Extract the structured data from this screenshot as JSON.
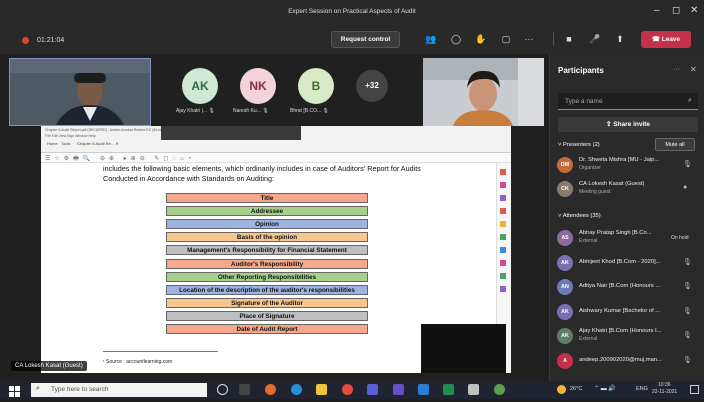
{
  "window": {
    "title": "Expert Session on Practical Aspects of Audit"
  },
  "meeting": {
    "timer": "01:21:04",
    "request_control": "Request control",
    "leave": "Leave"
  },
  "gallery": {
    "avatars": [
      {
        "initials": "AK",
        "name": "Ajay Khatri |...",
        "bg": "#cfe8d4",
        "fg": "#2e6b3d"
      },
      {
        "initials": "NK",
        "name": "Naresh Ku...",
        "bg": "#f3d3da",
        "fg": "#8a2c43"
      },
      {
        "initials": "B",
        "name": "Bhrat [B.CO...",
        "bg": "#d7ebc9",
        "fg": "#456b2c"
      }
    ],
    "more": "+32"
  },
  "presenter_label": "CA Lokesh Kasat (Guest)",
  "document": {
    "intro": "includes the following basic elements, which ordinarily includes in case of Auditors' Report for Audits Conducted in Accordance with Standards on Auditing:",
    "steps": [
      {
        "label": "Title",
        "color": "#f4a98a"
      },
      {
        "label": "Addressee",
        "color": "#a8d08d"
      },
      {
        "label": "Opinion",
        "color": "#9db4e3"
      },
      {
        "label": "Basis of the opinion",
        "color": "#f7c58e"
      },
      {
        "label": "Management's Responsibility for Financial Statement",
        "color": "#bfbfbf"
      },
      {
        "label": "Auditor's Responsibility",
        "color": "#f4a98a"
      },
      {
        "label": "Other Reporting Responsibilities",
        "color": "#a8d08d"
      },
      {
        "label": "Location of the description of the auditor's responsibilities",
        "color": "#9db4e3"
      },
      {
        "label": "Signature of the Auditor",
        "color": "#f7c58e"
      },
      {
        "label": "Place of Signature",
        "color": "#bfbfbf"
      },
      {
        "label": "Date of Audit Report",
        "color": "#f4a98a"
      }
    ],
    "source": "¹ Source : accountlearning.com"
  },
  "participants": {
    "title": "Participants",
    "search_placeholder": "Type a name",
    "share_invite": "Share invite",
    "presenters_header": "Presenters (2)",
    "mute_all": "Mute all",
    "presenters": [
      {
        "initials": "DM",
        "name": "Dr. Shweta Mishra [MU - Jaip...",
        "sub": "Organizer",
        "color": "#c46a3c"
      },
      {
        "initials": "CK",
        "name": "CA Lokesh Kasat (Guest)",
        "sub": "Meeting guest",
        "color": "#8a7a6b"
      }
    ],
    "attendees_header": "Attendees (35)",
    "attendees": [
      {
        "initials": "AS",
        "name": "Abhay Pratap Singh [B.Co...",
        "sub": "External",
        "status": "On hold",
        "color": "#8c6a9c"
      },
      {
        "initials": "AK",
        "name": "Abhijeet Khod [B.Com - 2020]...",
        "sub": "",
        "status": "",
        "color": "#7c6fb1"
      },
      {
        "initials": "AN",
        "name": "Aditya Nair [B.Com (Honours ...",
        "sub": "",
        "status": "",
        "color": "#6b7bb3"
      },
      {
        "initials": "AK",
        "name": "Aishwary Kumar [Bachelor of ...",
        "sub": "",
        "status": "",
        "color": "#7c6fb1"
      },
      {
        "initials": "AK",
        "name": "Ajay Khatri [B.Com (Honours I...",
        "sub": "External",
        "status": "",
        "color": "#5f7f65"
      },
      {
        "initials": "A",
        "name": "andeep.200902020@muj.man...",
        "sub": "",
        "status": "",
        "color": "#c4314b"
      }
    ]
  },
  "taskbar": {
    "search_placeholder": "Type here to search",
    "weather": "26°C",
    "lang": "ENG",
    "time": "10:36",
    "date": "22-11-2021"
  }
}
